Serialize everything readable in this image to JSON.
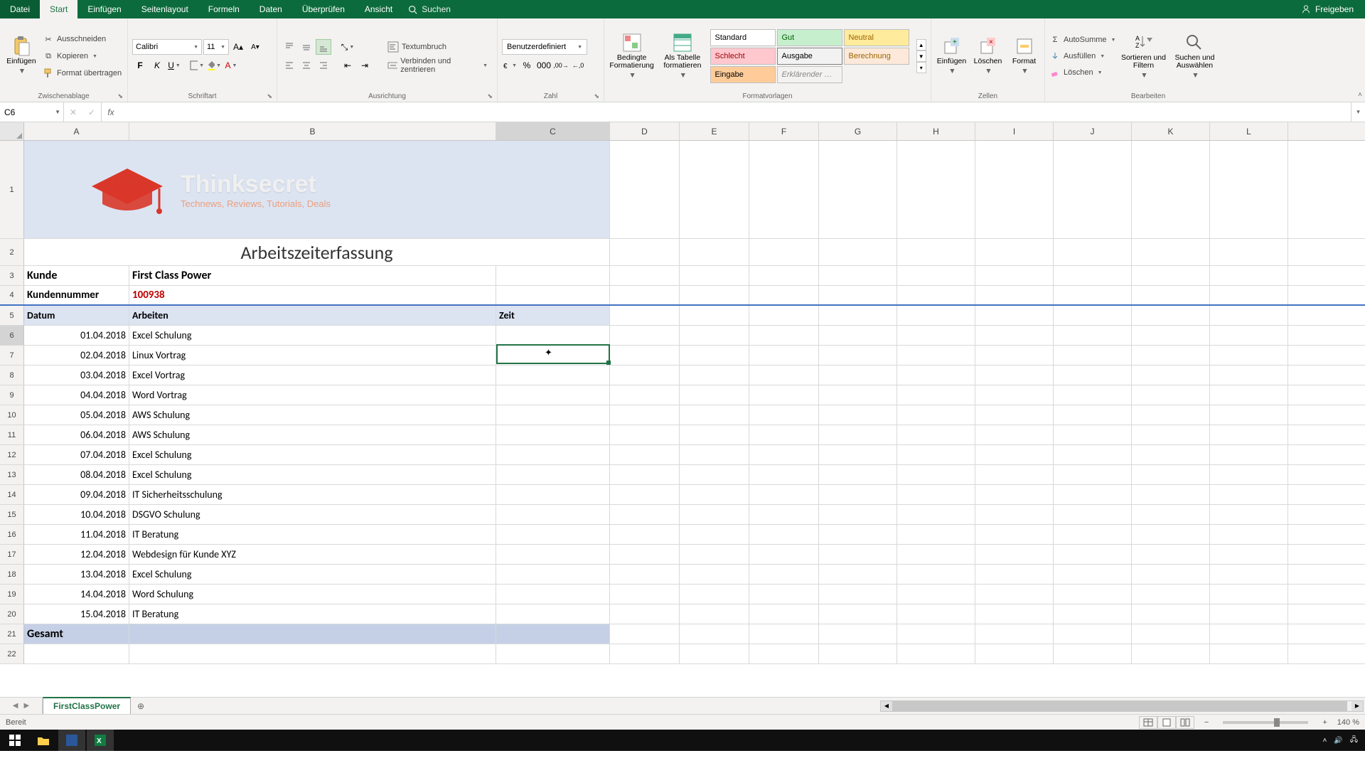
{
  "tabs": {
    "file": "Datei",
    "start": "Start",
    "insert": "Einfügen",
    "pagelayout": "Seitenlayout",
    "formulas": "Formeln",
    "data": "Daten",
    "review": "Überprüfen",
    "view": "Ansicht",
    "search": "Suchen",
    "share": "Freigeben"
  },
  "ribbon": {
    "clipboard": {
      "paste": "Einfügen",
      "cut": "Ausschneiden",
      "copy": "Kopieren",
      "formatpainter": "Format übertragen",
      "label": "Zwischenablage"
    },
    "font": {
      "name": "Calibri",
      "size": "11",
      "label": "Schriftart"
    },
    "align": {
      "wrap": "Textumbruch",
      "merge": "Verbinden und zentrieren",
      "label": "Ausrichtung"
    },
    "number": {
      "format": "Benutzerdefiniert",
      "label": "Zahl"
    },
    "styles": {
      "cond": "Bedingte Formatierung",
      "table": "Als Tabelle formatieren",
      "s1": "Standard",
      "s2": "Gut",
      "s3": "Neutral",
      "s4": "Schlecht",
      "s5": "Ausgabe",
      "s6": "Berechnung",
      "s7": "Eingabe",
      "s8": "Erklärender …",
      "label": "Formatvorlagen"
    },
    "cells": {
      "insert": "Einfügen",
      "delete": "Löschen",
      "format": "Format",
      "label": "Zellen"
    },
    "editing": {
      "autosum": "AutoSumme",
      "fill": "Ausfüllen",
      "clear": "Löschen",
      "sort": "Sortieren und Filtern",
      "find": "Suchen und Auswählen",
      "label": "Bearbeiten"
    }
  },
  "namebox": "C6",
  "formula": "",
  "columns": [
    "A",
    "B",
    "C",
    "D",
    "E",
    "F",
    "G",
    "H",
    "I",
    "J",
    "K",
    "L"
  ],
  "sheet": {
    "title": "Arbeitszeiterfassung",
    "logo_main": "Thinksecret",
    "logo_sub": "Technews, Reviews, Tutorials, Deals",
    "kunde_label": "Kunde",
    "kunde_value": "First Class Power",
    "kdnr_label": "Kundennummer",
    "kdnr_value": "100938",
    "col_datum": "Datum",
    "col_arbeiten": "Arbeiten",
    "col_zeit": "Zeit",
    "rows": [
      {
        "d": "01.04.2018",
        "a": "Excel Schulung"
      },
      {
        "d": "02.04.2018",
        "a": "Linux Vortrag"
      },
      {
        "d": "03.04.2018",
        "a": "Excel Vortrag"
      },
      {
        "d": "04.04.2018",
        "a": "Word Vortrag"
      },
      {
        "d": "05.04.2018",
        "a": "AWS Schulung"
      },
      {
        "d": "06.04.2018",
        "a": "AWS Schulung"
      },
      {
        "d": "07.04.2018",
        "a": "Excel Schulung"
      },
      {
        "d": "08.04.2018",
        "a": "Excel Schulung"
      },
      {
        "d": "09.04.2018",
        "a": "IT Sicherheitsschulung"
      },
      {
        "d": "10.04.2018",
        "a": "DSGVO Schulung"
      },
      {
        "d": "11.04.2018",
        "a": "IT Beratung"
      },
      {
        "d": "12.04.2018",
        "a": "Webdesign für Kunde XYZ"
      },
      {
        "d": "13.04.2018",
        "a": "Excel Schulung"
      },
      {
        "d": "14.04.2018",
        "a": "Word Schulung"
      },
      {
        "d": "15.04.2018",
        "a": "IT Beratung"
      }
    ],
    "total": "Gesamt"
  },
  "sheettab": "FirstClassPower",
  "status": "Bereit",
  "zoom": "140 %"
}
